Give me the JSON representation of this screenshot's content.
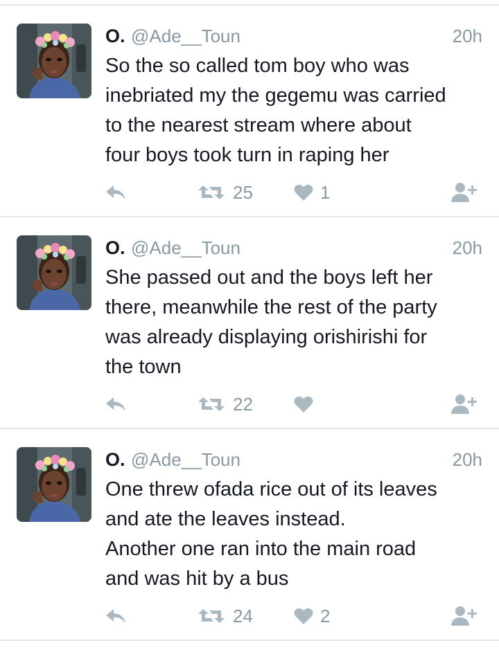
{
  "colors": {
    "text": "#141823",
    "muted": "#8899a6",
    "divider": "#e1e8ed",
    "icon": "#aab8c2"
  },
  "tweets": [
    {
      "name": "O.",
      "handle": "@Ade__Toun",
      "time": "20h",
      "text": "So the so called tom boy who was\ninebriated my the gegemu was carried\nto the nearest stream where about\nfour boys took turn in raping her",
      "retweets": "25",
      "likes": "1",
      "icons": [
        "reply-icon",
        "retweet-icon",
        "heart-icon",
        "follow-icon"
      ]
    },
    {
      "name": "O.",
      "handle": "@Ade__Toun",
      "time": "20h",
      "text": "She passed out and the boys left her\nthere, meanwhile the rest of the party\nwas already displaying orishirishi for\nthe town",
      "retweets": "22",
      "likes": "",
      "icons": [
        "reply-icon",
        "retweet-icon",
        "heart-icon",
        "follow-icon"
      ]
    },
    {
      "name": "O.",
      "handle": "@Ade__Toun",
      "time": "20h",
      "text": "One threw ofada rice out of its leaves\nand ate the leaves instead.\nAnother one ran into the main road\nand was hit by a bus",
      "retweets": "24",
      "likes": "2",
      "icons": [
        "reply-icon",
        "retweet-icon",
        "heart-icon",
        "follow-icon"
      ]
    }
  ]
}
